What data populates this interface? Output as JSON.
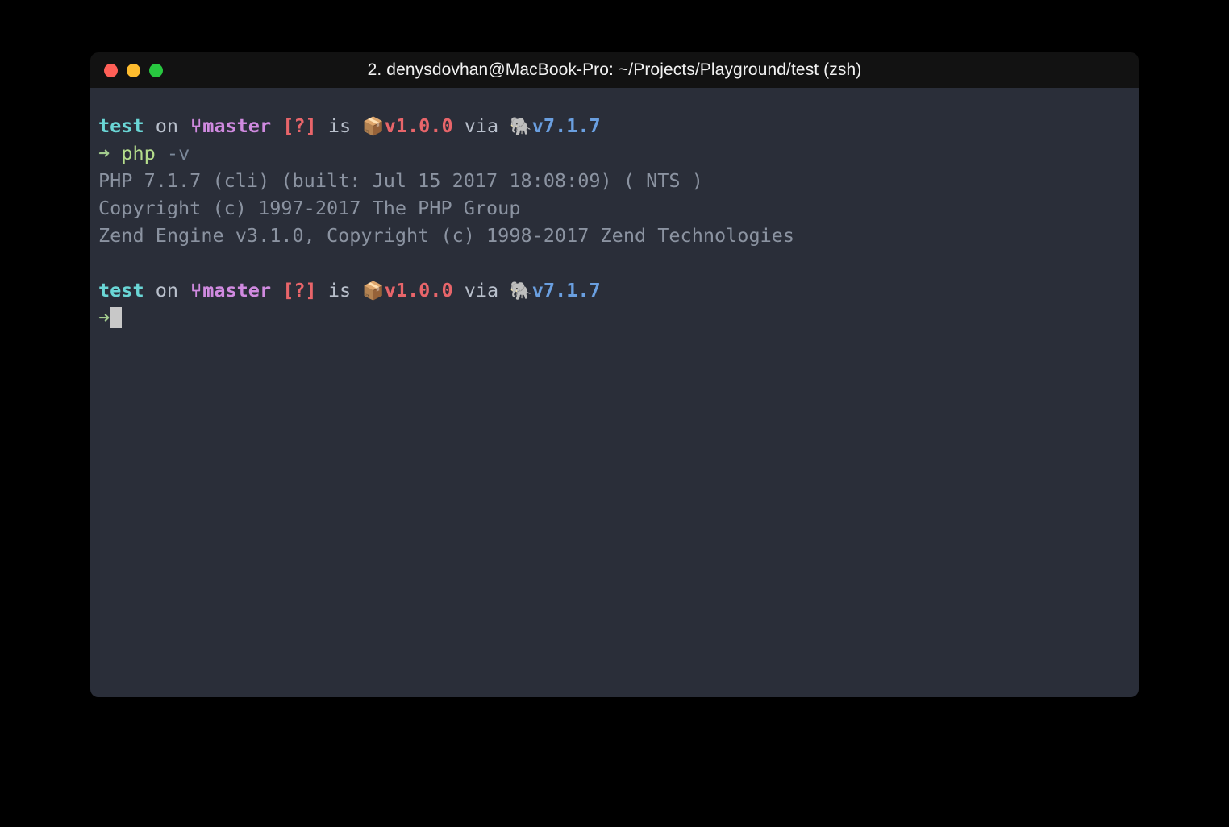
{
  "window": {
    "title": "2. denysdovhan@MacBook-Pro: ~/Projects/Playground/test (zsh)",
    "traffic_lights": {
      "close_label": "close",
      "minimize_label": "minimize",
      "zoom_label": "zoom"
    },
    "colors": {
      "titlebar_bg": "#121212",
      "terminal_bg": "#2a2e39",
      "desktop_bg": "#000000",
      "close": "#ff5f57",
      "minimize": "#febc2e",
      "zoom": "#28c840"
    }
  },
  "terminal": {
    "colors": {
      "directory": "#6ad6d6",
      "plain": "#b9c0cc",
      "branch": "#d08ae0",
      "status": "#e8656a",
      "package_version": "#e8656a",
      "php_version": "#6a9fe0",
      "arrow": "#a3cc8e",
      "command": "#b5dd8c",
      "argument": "#7c899b",
      "output": "#8b93a1",
      "cursor": "#c8c8c8"
    },
    "prompt": {
      "directory": "test",
      "on_word": "on",
      "branch_icon": "⑂",
      "branch_name": "master",
      "git_status": "[?]",
      "is_word": "is",
      "package_icon": "📦",
      "package_version": "v1.0.0",
      "via_word": "via",
      "php_icon": "🐘",
      "php_version": "v7.1.7",
      "arrow_icon": "➜"
    },
    "command": {
      "name": "php",
      "argument": "-v"
    },
    "output_lines": [
      "PHP 7.1.7 (cli) (built: Jul 15 2017 18:08:09) ( NTS )",
      "Copyright (c) 1997-2017 The PHP Group",
      "Zend Engine v3.1.0, Copyright (c) 1998-2017 Zend Technologies"
    ],
    "cursor": {
      "visible": true
    }
  }
}
